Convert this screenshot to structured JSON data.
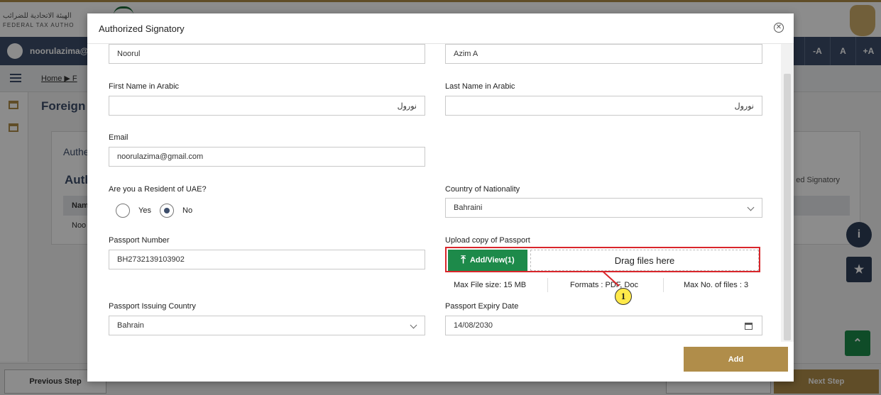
{
  "background": {
    "logo_ar": "الهيئة الاتحادية للضرائب",
    "logo_en": "FEDERAL TAX AUTHO",
    "user_name": "noorulazima@g",
    "font_controls": [
      "-A",
      "A",
      "+A"
    ],
    "breadcrumb": "Home ▶ F",
    "page_title": "Foreign",
    "card_title": "Authe",
    "card_subtitle": "Auth",
    "table_header": "Nam",
    "table_cell": "Noo",
    "card_right_label": "ed Signatory",
    "info_label": "i",
    "star_label": "★",
    "top_label": "⌃",
    "prev_step": "Previous Step",
    "next_step": "Next Step"
  },
  "modal": {
    "title": "Authorized Signatory",
    "fields": {
      "first_name": "Noorul",
      "last_name": "Azim A",
      "first_name_arabic_label": "First Name in Arabic",
      "first_name_arabic": "نورول",
      "last_name_arabic_label": "Last Name in Arabic",
      "last_name_arabic": "نورول",
      "email_label": "Email",
      "email": "noorulazima@gmail.com",
      "resident_label": "Are you a Resident of UAE?",
      "resident_yes": "Yes",
      "resident_no": "No",
      "nationality_label": "Country of Nationality",
      "nationality": "Bahraini",
      "passport_number_label": "Passport Number",
      "passport_number": "BH2732139103902",
      "upload_label": "Upload copy of Passport",
      "upload_button": "Add/View(1)",
      "dropzone": "Drag files here",
      "max_size": "Max File size: 15 MB",
      "formats": "Formats : PDF, Doc",
      "max_files": "Max No. of files : 3",
      "issuing_country_label": "Passport Issuing Country",
      "issuing_country": "Bahrain",
      "expiry_label": "Passport Expiry Date",
      "expiry_date": "14/08/2030"
    },
    "add_button": "Add",
    "marker": "1"
  }
}
